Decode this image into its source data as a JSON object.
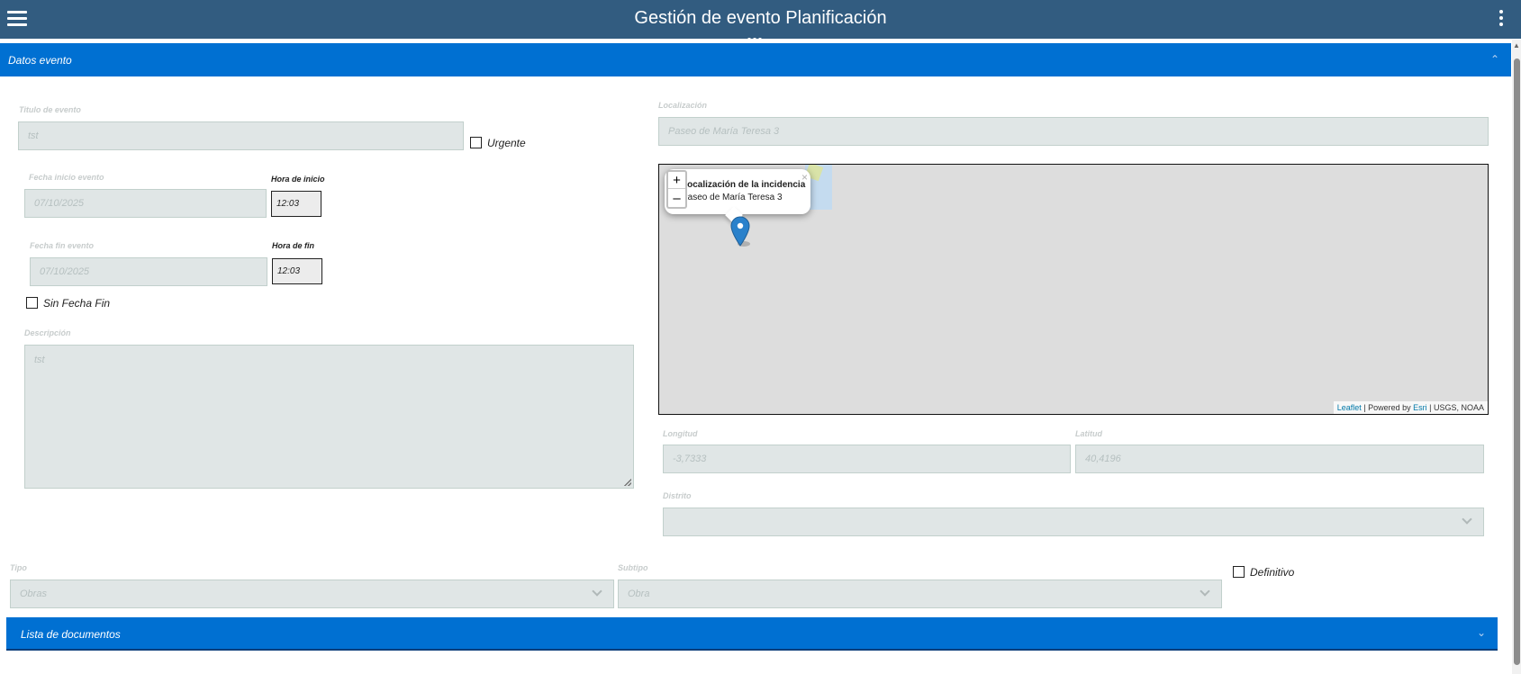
{
  "header": {
    "title": "Gestión de evento Planificación"
  },
  "sections": {
    "datos_evento": "Datos evento",
    "lista_documentos": "Lista de documentos"
  },
  "form": {
    "titulo": {
      "label": "Titulo de evento",
      "value": "tst"
    },
    "urgente": {
      "label": "Urgente",
      "checked": false
    },
    "fecha_inicio": {
      "label": "Fecha inicio evento",
      "value": "07/10/2025"
    },
    "hora_inicio": {
      "label": "Hora de inicio",
      "value": "12:03"
    },
    "fecha_fin": {
      "label": "Fecha fin evento",
      "value": "07/10/2025"
    },
    "hora_fin": {
      "label": "Hora de fin",
      "value": "12:03"
    },
    "sin_fecha_fin": {
      "label": "Sin Fecha Fin",
      "checked": false
    },
    "descripcion": {
      "label": "Descripción",
      "value": "tst"
    },
    "localizacion": {
      "label": "Localización",
      "value": "Paseo de María Teresa 3"
    },
    "longitud": {
      "label": "Longitud",
      "value": "-3,7333"
    },
    "latitud": {
      "label": "Latitud",
      "value": "40,4196"
    },
    "distrito": {
      "label": "Distrito",
      "value": ""
    },
    "tipo": {
      "label": "Tipo",
      "value": "Obras"
    },
    "subtipo": {
      "label": "Subtipo",
      "value": "Obra"
    },
    "definitivo": {
      "label": "Definitivo",
      "checked": false
    }
  },
  "map": {
    "zoom_in": "+",
    "zoom_out": "–",
    "popup_title": "Localización de la incidencia",
    "popup_text": "Paseo de María Teresa 3",
    "popup_close": "×",
    "attribution": {
      "leaflet": "Leaflet",
      "sep1": " | Powered by ",
      "esri": "Esri",
      "sep2": " | USGS, NOAA"
    },
    "marker_color": "#2a81cb"
  },
  "colors": {
    "topbar": "#325c80",
    "section": "#0070d2"
  },
  "icons": {
    "menu": "hamburger-menu-icon",
    "more": "kebab-menu-icon",
    "collapse": "chevron-up-icon",
    "expand": "chevron-down-icon"
  }
}
